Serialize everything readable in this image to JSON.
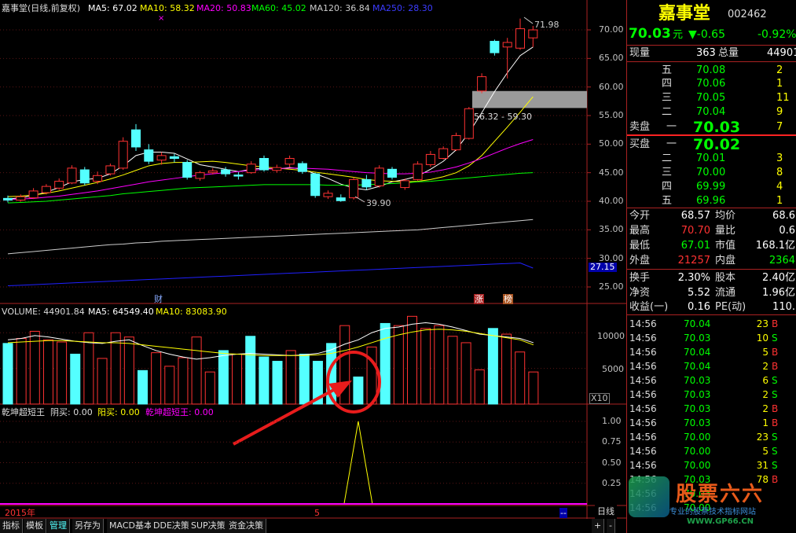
{
  "chart_header": {
    "title": "嘉事堂(日线,前复权)",
    "ma5": "MA5: 67.02",
    "ma10": "MA10: 58.32",
    "ma20": "MA20: 50.83",
    "ma60": "MA60: 45.02",
    "ma120": "MA120: 36.84",
    "ma250": "MA250: 28.30"
  },
  "colors": {
    "up": "#ff3232",
    "down": "#54ffff",
    "ma5": "#ffffff",
    "ma10": "#ffff00",
    "ma20": "#ff00ff",
    "ma60": "#00ff00",
    "ma120": "#cccccc",
    "ma250": "#2020ff"
  },
  "price_axis": [
    "70.00",
    "65.00",
    "60.00",
    "55.00",
    "50.00",
    "45.00",
    "40.00",
    "35.00",
    "30.00",
    "25.00"
  ],
  "current_price_marker": "27.15",
  "annotations": {
    "high": "71.98",
    "low": "39.90",
    "gap": "56.32 - 59.30",
    "cai": "财",
    "zhang": "涨",
    "bang": "榜"
  },
  "volume_header": {
    "vol": "VOLUME: 44901.84",
    "ma5": "MA5: 64549.40",
    "ma10": "MA10: 83083.90"
  },
  "volume_axis": [
    "10000",
    "5000"
  ],
  "volume_unit": "X10",
  "indicator_header": {
    "name": "乾坤超短王",
    "yin": "阴买: 0.00",
    "yang": "阳买: 0.00",
    "val": "乾坤超短王: 0.00"
  },
  "indicator_axis": [
    "1.00",
    "0.75",
    "0.50",
    "0.25"
  ],
  "time_axis": {
    "year": "2015年",
    "month": "5",
    "marker": "--"
  },
  "bottom_tabs": [
    "指标",
    "模板",
    "管理",
    "另存为",
    "MACD基本",
    "DDE决策",
    "SUP决策",
    "资金决策"
  ],
  "bottom_right": {
    "period": "日线",
    "plus": "+",
    "minus": "-"
  },
  "stock": {
    "name": "嘉事堂",
    "code": "002462",
    "price": "70.03",
    "unit": "元",
    "change": "▼-0.65",
    "pct": "-0.92%"
  },
  "volume_info": {
    "xianliang_label": "现量",
    "xianliang": "363",
    "zongliang_label": "总量",
    "zongliang": "44901"
  },
  "sell": [
    {
      "label": "五",
      "price": "70.08",
      "vol": "2"
    },
    {
      "label": "四",
      "price": "70.06",
      "vol": "1"
    },
    {
      "label": "三",
      "price": "70.05",
      "vol": "11"
    },
    {
      "label": "二",
      "price": "70.04",
      "vol": "9"
    },
    {
      "label": "卖盘 一",
      "price": "70.03",
      "vol": "7"
    }
  ],
  "buy": [
    {
      "label": "买盘 一",
      "price": "70.02",
      "vol": ""
    },
    {
      "label": "二",
      "price": "70.01",
      "vol": "3"
    },
    {
      "label": "三",
      "price": "70.00",
      "vol": "8"
    },
    {
      "label": "四",
      "price": "69.99",
      "vol": "4"
    },
    {
      "label": "五",
      "price": "69.96",
      "vol": "1"
    }
  ],
  "stats": [
    {
      "l1": "今开",
      "v1": "68.57",
      "l2": "均价",
      "v2": "68.6"
    },
    {
      "l1": "最高",
      "v1": "70.70",
      "l2": "量比",
      "v2": "0.6"
    },
    {
      "l1": "最低",
      "v1": "67.01",
      "l2": "市值",
      "v2": "168.1亿"
    },
    {
      "l1": "外盘",
      "v1": "21257",
      "l2": "内盘",
      "v2": "2364"
    }
  ],
  "stats2": [
    {
      "l1": "换手",
      "v1": "2.30%",
      "l2": "股本",
      "v2": "2.40亿"
    },
    {
      "l1": "净资",
      "v1": "5.52",
      "l2": "流通",
      "v2": "1.96亿"
    },
    {
      "l1": "收益(一)",
      "v1": "0.16",
      "l2": "PE(动)",
      "v2": "110."
    }
  ],
  "ticks": [
    {
      "t": "14:56",
      "p": "70.04",
      "v": "23",
      "bs": "B"
    },
    {
      "t": "14:56",
      "p": "70.03",
      "v": "10",
      "bs": "S"
    },
    {
      "t": "14:56",
      "p": "70.04",
      "v": "5",
      "bs": "B"
    },
    {
      "t": "14:56",
      "p": "70.04",
      "v": "2",
      "bs": "B"
    },
    {
      "t": "14:56",
      "p": "70.03",
      "v": "6",
      "bs": "S"
    },
    {
      "t": "14:56",
      "p": "70.03",
      "v": "2",
      "bs": "S"
    },
    {
      "t": "14:56",
      "p": "70.03",
      "v": "2",
      "bs": "B"
    },
    {
      "t": "14:56",
      "p": "70.03",
      "v": "1",
      "bs": "B"
    },
    {
      "t": "14:56",
      "p": "70.00",
      "v": "23",
      "bs": "S"
    },
    {
      "t": "14:56",
      "p": "70.00",
      "v": "5",
      "bs": "S"
    },
    {
      "t": "14:56",
      "p": "70.00",
      "v": "31",
      "bs": "S"
    },
    {
      "t": "14:56",
      "p": "70.03",
      "v": "78",
      "bs": "B"
    },
    {
      "t": "14:56",
      "p": "70.03",
      "v": "",
      "bs": ""
    },
    {
      "t": "14:56",
      "p": "70.00",
      "v": "",
      "bs": ""
    }
  ],
  "watermark": {
    "title": "股票六六",
    "url": "WWW.GP66.CN",
    "slogan": "专业的股票技术指标网站"
  },
  "candles": [
    {
      "o": 40.5,
      "c": 40.2,
      "h": 41.0,
      "l": 39.8
    },
    {
      "o": 40.2,
      "c": 40.8,
      "h": 41.2,
      "l": 39.9
    },
    {
      "o": 40.6,
      "c": 41.8,
      "h": 42.3,
      "l": 40.4
    },
    {
      "o": 41.5,
      "c": 42.6,
      "h": 43.0,
      "l": 41.2
    },
    {
      "o": 42.3,
      "c": 43.5,
      "h": 44.0,
      "l": 42.0
    },
    {
      "o": 43.2,
      "c": 45.8,
      "h": 46.3,
      "l": 43.0
    },
    {
      "o": 45.5,
      "c": 43.2,
      "h": 46.0,
      "l": 42.8
    },
    {
      "o": 43.5,
      "c": 44.5,
      "h": 45.2,
      "l": 43.0
    },
    {
      "o": 44.8,
      "c": 46.2,
      "h": 46.6,
      "l": 44.5
    },
    {
      "o": 45.8,
      "c": 50.5,
      "h": 51.2,
      "l": 45.5
    },
    {
      "o": 52.5,
      "c": 49.5,
      "h": 53.5,
      "l": 48.8
    },
    {
      "o": 49.0,
      "c": 47.0,
      "h": 50.0,
      "l": 46.5
    },
    {
      "o": 47.2,
      "c": 48.0,
      "h": 48.6,
      "l": 46.4
    },
    {
      "o": 47.8,
      "c": 47.5,
      "h": 48.3,
      "l": 46.8
    },
    {
      "o": 46.8,
      "c": 44.2,
      "h": 47.2,
      "l": 43.8
    },
    {
      "o": 44.0,
      "c": 45.0,
      "h": 45.3,
      "l": 43.6
    },
    {
      "o": 45.0,
      "c": 45.3,
      "h": 45.8,
      "l": 44.7
    },
    {
      "o": 45.5,
      "c": 44.8,
      "h": 46.0,
      "l": 44.3
    },
    {
      "o": 44.6,
      "c": 44.4,
      "h": 45.1,
      "l": 43.8
    },
    {
      "o": 45.0,
      "c": 46.5,
      "h": 47.0,
      "l": 44.8
    },
    {
      "o": 47.5,
      "c": 45.5,
      "h": 48.0,
      "l": 45.2
    },
    {
      "o": 45.4,
      "c": 45.9,
      "h": 46.4,
      "l": 45.0
    },
    {
      "o": 46.5,
      "c": 47.5,
      "h": 48.0,
      "l": 46.0
    },
    {
      "o": 46.6,
      "c": 45.2,
      "h": 47.0,
      "l": 44.8
    },
    {
      "o": 44.8,
      "c": 41.0,
      "h": 45.0,
      "l": 40.6
    },
    {
      "o": 40.8,
      "c": 41.4,
      "h": 41.9,
      "l": 40.4
    },
    {
      "o": 40.6,
      "c": 40.1,
      "h": 41.2,
      "l": 39.9
    },
    {
      "o": 40.6,
      "c": 43.8,
      "h": 44.2,
      "l": 40.3
    },
    {
      "o": 43.8,
      "c": 42.5,
      "h": 44.6,
      "l": 42.0
    },
    {
      "o": 42.7,
      "c": 45.8,
      "h": 46.3,
      "l": 42.4
    },
    {
      "o": 45.6,
      "c": 44.2,
      "h": 46.0,
      "l": 43.8
    },
    {
      "o": 42.4,
      "c": 43.6,
      "h": 44.0,
      "l": 42.0
    },
    {
      "o": 43.8,
      "c": 46.5,
      "h": 47.0,
      "l": 43.6
    },
    {
      "o": 46.4,
      "c": 48.2,
      "h": 48.8,
      "l": 46.0
    },
    {
      "o": 47.5,
      "c": 49.2,
      "h": 49.6,
      "l": 47.3
    },
    {
      "o": 49.0,
      "c": 51.5,
      "h": 52.0,
      "l": 48.8
    },
    {
      "o": 51.0,
      "c": 56.2,
      "h": 56.5,
      "l": 50.8
    },
    {
      "o": 59.3,
      "c": 61.8,
      "h": 62.4,
      "l": 58.9
    },
    {
      "o": 68.0,
      "c": 66.0,
      "h": 68.3,
      "l": 65.5
    },
    {
      "o": 67.0,
      "c": 67.8,
      "h": 68.6,
      "l": 61.5
    },
    {
      "o": 66.8,
      "c": 70.2,
      "h": 71.98,
      "l": 66.5
    },
    {
      "o": 68.6,
      "c": 70.0,
      "h": 70.7,
      "l": 67.0
    }
  ],
  "volumes": [
    {
      "v": 8500,
      "up": false
    },
    {
      "v": 9200,
      "up": true
    },
    {
      "v": 10200,
      "up": true
    },
    {
      "v": 9000,
      "up": true
    },
    {
      "v": 8700,
      "up": true
    },
    {
      "v": 7000,
      "up": false
    },
    {
      "v": 10000,
      "up": true
    },
    {
      "v": 6400,
      "up": true
    },
    {
      "v": 10000,
      "up": true
    },
    {
      "v": 9400,
      "up": true
    },
    {
      "v": 4700,
      "up": false
    },
    {
      "v": 7200,
      "up": true
    },
    {
      "v": 5300,
      "up": true
    },
    {
      "v": 6500,
      "up": true
    },
    {
      "v": 9400,
      "up": true
    },
    {
      "v": 4500,
      "up": true
    },
    {
      "v": 7500,
      "up": false
    },
    {
      "v": 7000,
      "up": true
    },
    {
      "v": 9500,
      "up": false
    },
    {
      "v": 6600,
      "up": false
    },
    {
      "v": 6000,
      "up": false
    },
    {
      "v": 7500,
      "up": true
    },
    {
      "v": 7000,
      "up": false
    },
    {
      "v": 6000,
      "up": false
    },
    {
      "v": 8500,
      "up": false
    },
    {
      "v": 11000,
      "up": true
    },
    {
      "v": 3800,
      "up": false
    },
    {
      "v": 8000,
      "up": true
    },
    {
      "v": 11300,
      "up": false
    },
    {
      "v": 11000,
      "up": true
    },
    {
      "v": 12300,
      "up": true
    },
    {
      "v": 10600,
      "up": true
    },
    {
      "v": 11000,
      "up": true
    },
    {
      "v": 9500,
      "up": true
    },
    {
      "v": 8600,
      "up": true
    },
    {
      "v": 4800,
      "up": true
    },
    {
      "v": 10600,
      "up": false
    },
    {
      "v": 9800,
      "up": true
    },
    {
      "v": 7300,
      "up": true
    },
    {
      "v": 4500,
      "up": true
    }
  ],
  "ma_lines": {
    "ma5": [
      40.4,
      40.6,
      41.0,
      41.6,
      42.4,
      43.4,
      43.8,
      44.0,
      44.8,
      46.2,
      48.0,
      48.6,
      48.6,
      48.4,
      47.4,
      46.4,
      46.0,
      45.6,
      45.2,
      45.6,
      45.8,
      45.6,
      45.9,
      45.6,
      44.8,
      44.0,
      43.0,
      42.3,
      42.0,
      42.6,
      43.4,
      43.8,
      44.4,
      45.6,
      47.0,
      49.0,
      52.0,
      55.5,
      59.2,
      62.5,
      65.5,
      67.0
    ],
    "ma10": [
      40.8,
      40.9,
      41.1,
      41.4,
      41.8,
      42.3,
      42.8,
      43.3,
      43.9,
      44.6,
      45.4,
      46.2,
      46.6,
      46.8,
      46.8,
      46.9,
      47.0,
      46.8,
      46.5,
      46.2,
      46.0,
      45.8,
      45.6,
      45.4,
      45.1,
      44.8,
      44.5,
      44.2,
      43.8,
      43.6,
      43.5,
      43.4,
      43.5,
      43.8,
      44.3,
      45.0,
      46.2,
      48.0,
      50.5,
      53.0,
      55.6,
      58.3
    ],
    "ma20": [
      40.3,
      40.4,
      40.5,
      40.7,
      40.9,
      41.2,
      41.5,
      41.8,
      42.2,
      42.6,
      43.0,
      43.4,
      43.7,
      44.0,
      44.3,
      44.6,
      44.8,
      45.0,
      45.2,
      45.4,
      45.6,
      45.7,
      45.8,
      45.8,
      45.7,
      45.6,
      45.4,
      45.2,
      45.0,
      44.9,
      44.8,
      44.8,
      44.9,
      45.1,
      45.5,
      46.0,
      46.7,
      47.5,
      48.4,
      49.3,
      50.1,
      50.8
    ],
    "ma60": [
      39.7,
      39.8,
      39.9,
      40.0,
      40.2,
      40.4,
      40.6,
      40.8,
      41.0,
      41.3,
      41.5,
      41.7,
      41.9,
      42.1,
      42.3,
      42.4,
      42.5,
      42.6,
      42.7,
      42.8,
      42.9,
      42.9,
      42.9,
      42.9,
      42.9,
      42.8,
      42.8,
      42.8,
      42.9,
      43.0,
      43.1,
      43.2,
      43.4,
      43.5,
      43.7,
      43.9,
      44.1,
      44.3,
      44.5,
      44.7,
      44.9,
      45.0
    ],
    "ma120": [
      30.8,
      31.0,
      31.2,
      31.4,
      31.6,
      31.8,
      32.0,
      32.2,
      32.4,
      32.5,
      32.7,
      32.8,
      33.0,
      33.1,
      33.2,
      33.3,
      33.4,
      33.5,
      33.6,
      33.7,
      33.8,
      33.9,
      34.0,
      34.1,
      34.2,
      34.3,
      34.4,
      34.5,
      34.6,
      34.7,
      34.8,
      34.9,
      35.0,
      35.2,
      35.4,
      35.6,
      35.8,
      36.0,
      36.2,
      36.4,
      36.6,
      36.8
    ],
    "ma250": [
      25.2,
      25.3,
      25.4,
      25.5,
      25.6,
      25.7,
      25.8,
      25.9,
      26.0,
      26.1,
      26.2,
      26.3,
      26.4,
      26.5,
      26.6,
      26.7,
      26.8,
      26.9,
      27.0,
      27.1,
      27.2,
      27.3,
      27.4,
      27.5,
      27.6,
      27.7,
      27.8,
      27.9,
      28.0,
      28.1,
      28.2,
      28.3,
      28.4,
      28.5,
      28.6,
      28.7,
      28.8,
      28.9,
      29.0,
      29.1,
      29.2,
      28.3
    ]
  },
  "vol_ma5": [
    9000,
    9200,
    9600,
    9400,
    9100,
    8800,
    8600,
    8500,
    8800,
    9000,
    8200,
    7500,
    7000,
    6600,
    6300,
    6500,
    6800,
    7000,
    7100,
    7000,
    6900,
    6800,
    6900,
    7100,
    7600,
    8400,
    9000,
    10000,
    10600,
    10800,
    11200,
    11400,
    11200,
    10800,
    10300,
    9800,
    9600,
    9400,
    9200,
    8600
  ],
  "vol_ma10": [
    8600,
    8700,
    8800,
    8900,
    8900,
    8800,
    8700,
    8600,
    8600,
    8500,
    8300,
    8100,
    7900,
    7700,
    7500,
    7300,
    7100,
    7000,
    6900,
    6800,
    6800,
    6800,
    6800,
    6900,
    7100,
    7500,
    8000,
    8600,
    9200,
    9700,
    10100,
    10400,
    10500,
    10400,
    10200,
    9900,
    9600,
    9300,
    9000,
    8300
  ],
  "indicator_signal": {
    "index": 26,
    "value": 1.0
  }
}
